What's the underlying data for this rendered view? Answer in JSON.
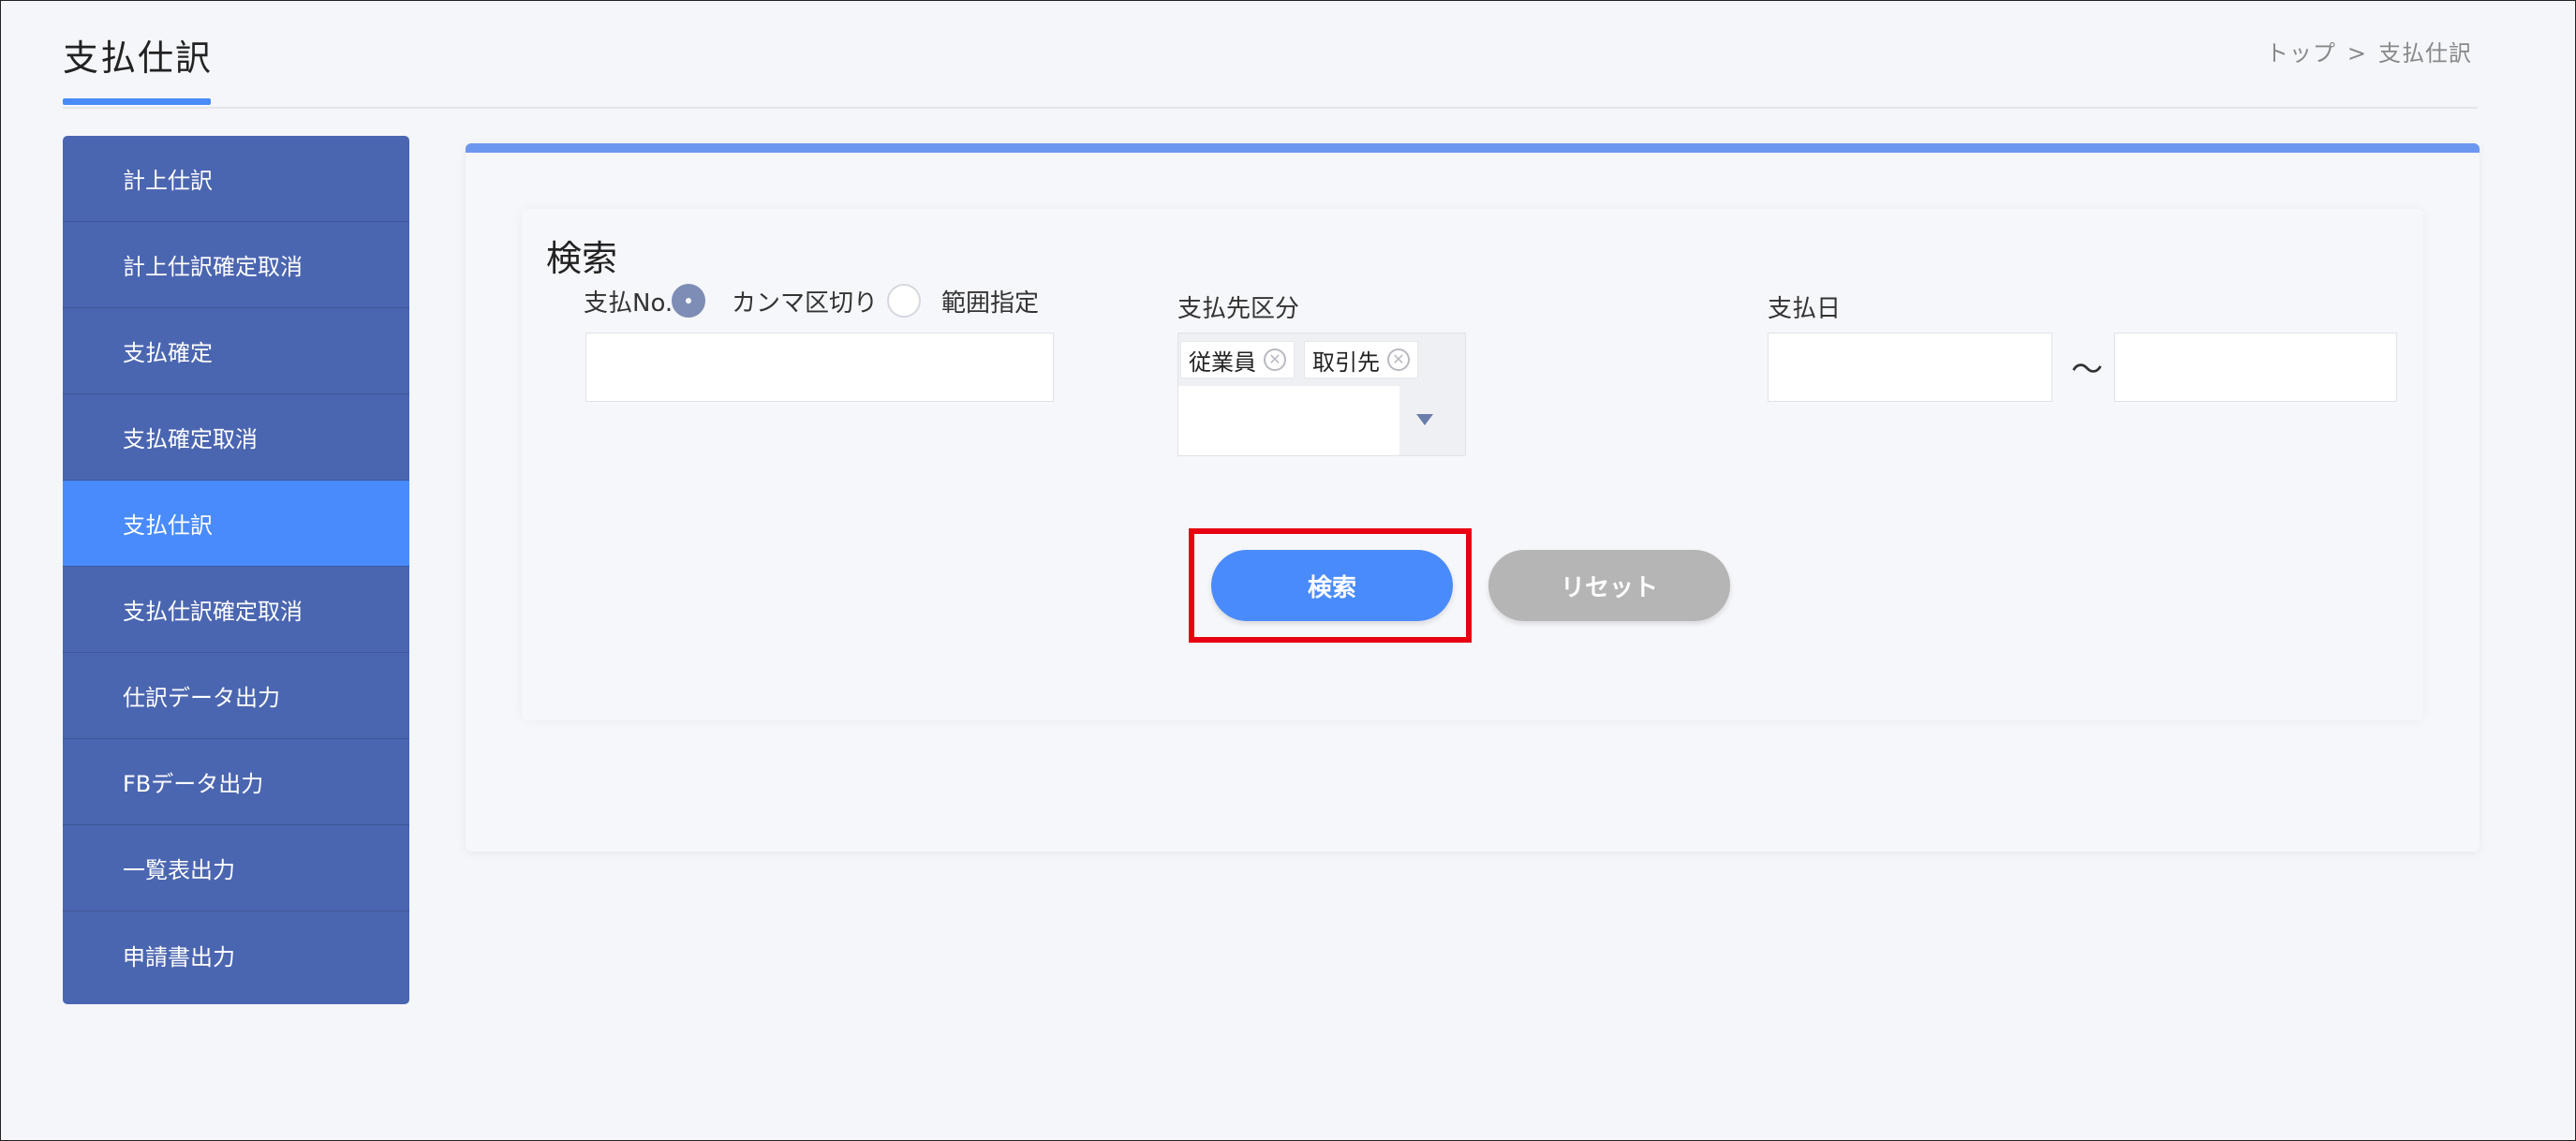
{
  "header": {
    "title": "支払仕訳",
    "breadcrumb": {
      "home": "トップ",
      "sep": ">",
      "current": "支払仕訳"
    }
  },
  "sidebar": {
    "items": [
      {
        "label": "計上仕訳"
      },
      {
        "label": "計上仕訳確定取消"
      },
      {
        "label": "支払確定"
      },
      {
        "label": "支払確定取消"
      },
      {
        "label": "支払仕訳"
      },
      {
        "label": "支払仕訳確定取消"
      },
      {
        "label": "仕訳データ出力"
      },
      {
        "label": "FBデータ出力"
      },
      {
        "label": "一覧表出力"
      },
      {
        "label": "申請書出力"
      }
    ],
    "active_index": 4
  },
  "search": {
    "title": "検索",
    "payment_no": {
      "label": "支払No.",
      "option_comma": "カンマ区切り",
      "option_range": "範囲指定",
      "selected": "カンマ区切り",
      "value": "",
      "placeholder": ""
    },
    "payee_type": {
      "label": "支払先区分",
      "tags": [
        "従業員",
        "取引先"
      ]
    },
    "payment_date": {
      "label": "支払日",
      "from": "",
      "separator": "〜",
      "to": ""
    },
    "search_button": "検索",
    "reset_button": "リセット"
  },
  "colors": {
    "accent": "#4a8bfb",
    "sidebar": "#4b66b0",
    "highlight": "#e60012"
  }
}
